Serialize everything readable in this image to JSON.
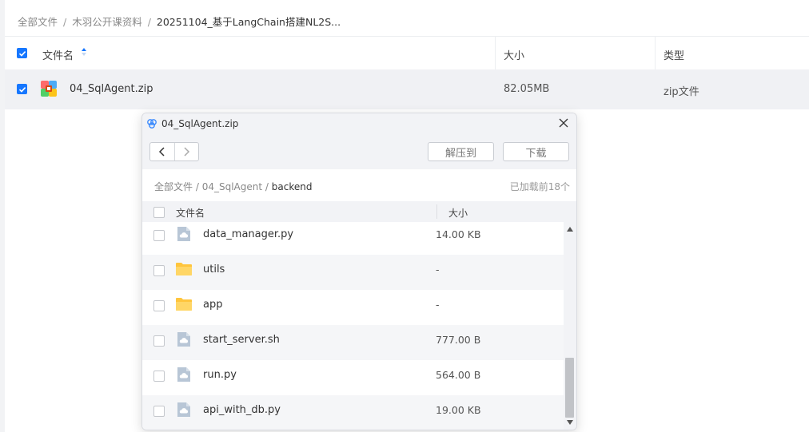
{
  "breadcrumb": {
    "items": [
      "全部文件",
      "木羽公开课资料"
    ],
    "separator": "/",
    "current": "20251104_基于LangChain搭建NL2S..."
  },
  "file_table": {
    "columns": {
      "name": "文件名",
      "size": "大小",
      "type": "类型"
    },
    "rows": [
      {
        "name": "04_SqlAgent.zip",
        "size": "82.05MB",
        "type": "zip文件",
        "selected": true,
        "icon": "zip-icon"
      }
    ]
  },
  "dialog": {
    "title": "04_SqlAgent.zip",
    "toolbar": {
      "extract_label": "解压到",
      "download_label": "下载"
    },
    "path": {
      "items": [
        "全部文件",
        "04_SqlAgent"
      ],
      "separator": "/",
      "current": "backend"
    },
    "loaded_text": "已加载前18个",
    "columns": {
      "name": "文件名",
      "size": "大小"
    },
    "files": [
      {
        "name": "data_manager.py",
        "size": "14.00 KB",
        "icon": "file-icon"
      },
      {
        "name": "utils",
        "size": "-",
        "icon": "folder-icon"
      },
      {
        "name": "app",
        "size": "-",
        "icon": "folder-icon"
      },
      {
        "name": "start_server.sh",
        "size": "777.00 B",
        "icon": "file-icon"
      },
      {
        "name": "run.py",
        "size": "564.00 B",
        "icon": "file-icon"
      },
      {
        "name": "api_with_db.py",
        "size": "19.00 KB",
        "icon": "file-icon"
      }
    ]
  },
  "colors": {
    "accent": "#1677ff",
    "folder": "#ffc53d",
    "file_icon": "#b8c6d6"
  }
}
